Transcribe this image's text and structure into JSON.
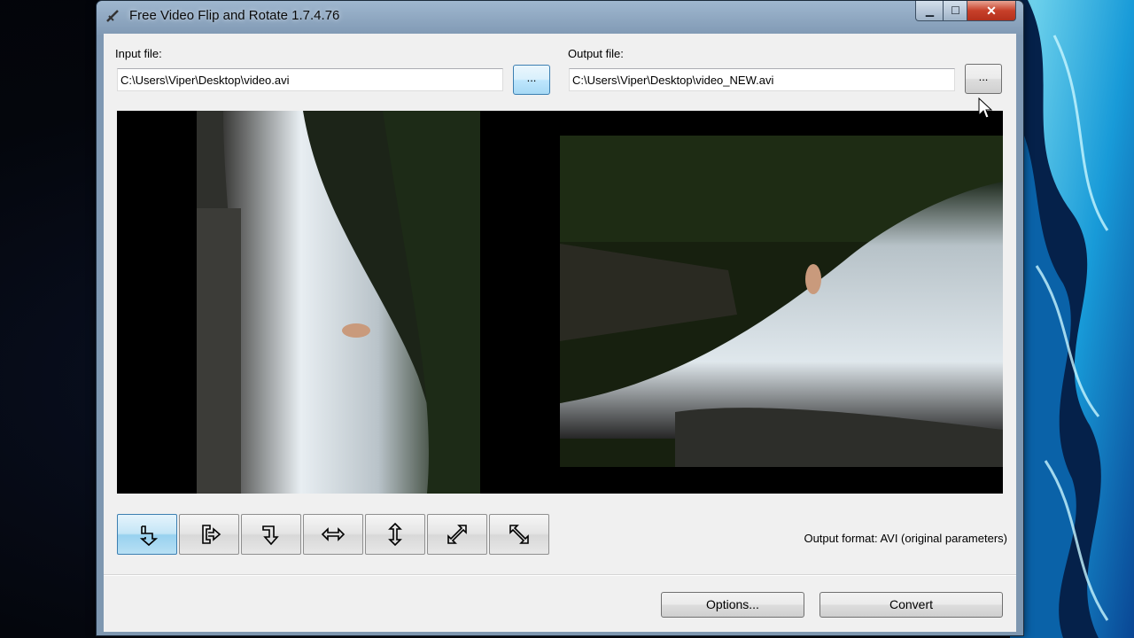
{
  "window": {
    "title": "Free Video Flip and Rotate 1.7.4.76",
    "caption_buttons": {
      "minimize": "▁",
      "maximize": "☐",
      "close": "✕"
    }
  },
  "input": {
    "label": "Input file:",
    "value": "C:\\Users\\Viper\\Desktop\\video.avi",
    "browse_label": "..."
  },
  "output": {
    "label": "Output file:",
    "value": "C:\\Users\\Viper\\Desktop\\video_NEW.avi",
    "browse_label": "..."
  },
  "toolbar": {
    "buttons": [
      {
        "icon": "rotate-left-90-icon",
        "active": true
      },
      {
        "icon": "rotate-right-90-icon",
        "active": false
      },
      {
        "icon": "rotate-180-icon",
        "active": false
      },
      {
        "icon": "flip-horizontal-icon",
        "active": false
      },
      {
        "icon": "flip-vertical-icon",
        "active": false
      },
      {
        "icon": "transpose-icon",
        "active": false
      },
      {
        "icon": "transverse-icon",
        "active": false
      }
    ]
  },
  "output_format": "Output format: AVI (original parameters)",
  "actions": {
    "options_label": "Options...",
    "convert_label": "Convert"
  },
  "colors": {
    "accent": "#3c7fb1",
    "frame": "#8ea7c0",
    "client_bg": "#f0f0f0"
  }
}
